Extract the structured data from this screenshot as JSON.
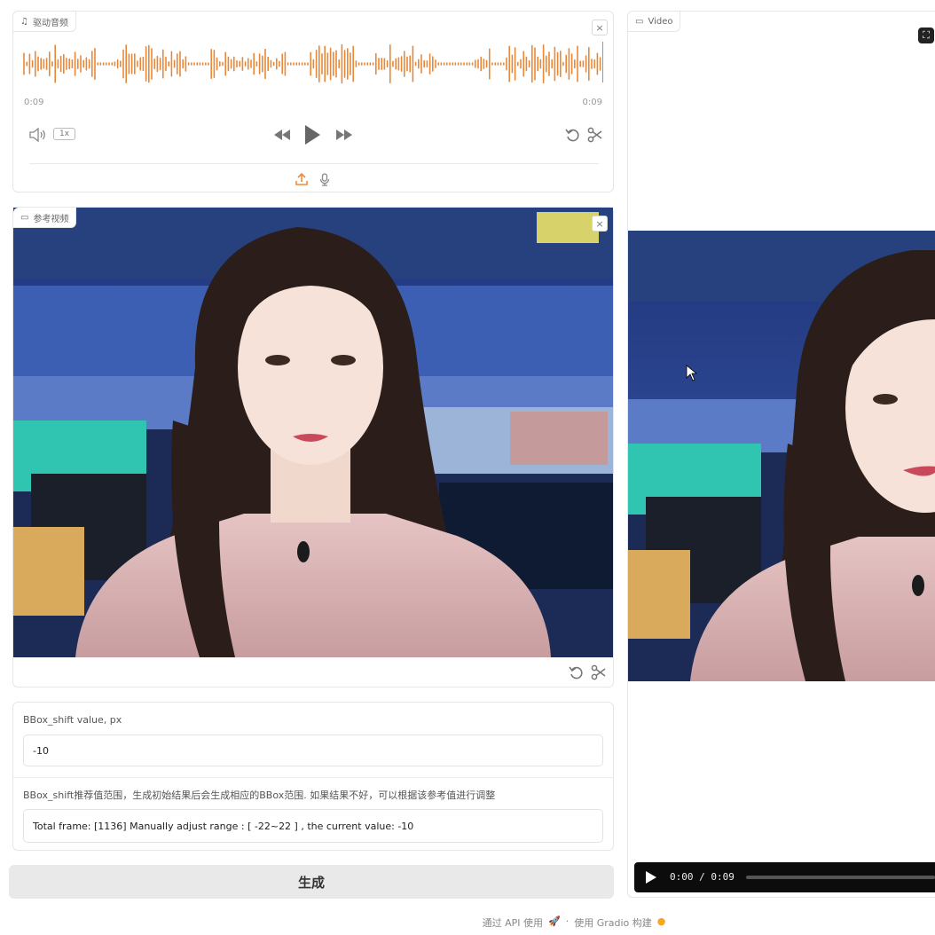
{
  "audio": {
    "label": "驱动音频",
    "time_start": "0:09",
    "time_end": "0:09",
    "speed": "1x",
    "close": "×"
  },
  "ref_video": {
    "label": "参考视频",
    "close": "×"
  },
  "output_video": {
    "label": "Video",
    "time_display": "0:00 / 0:09"
  },
  "bbox": {
    "label": "BBox_shift value, px",
    "value": "-10",
    "hint": "BBox_shift推荐值范围，生成初始结果后会生成相应的BBox范围. 如果结果不好，可以根据该参考值进行调整",
    "info": "Total frame: [1136]  Manually adjust range : [ -22~22 ] , the current value: -10"
  },
  "generate_button": "生成",
  "footer": {
    "api_text": "通过 API 使用",
    "sep": "·",
    "built_text": "使用 Gradio 构建"
  },
  "colors": {
    "waveform": "#e8883a",
    "accent": "#f08a3a"
  }
}
